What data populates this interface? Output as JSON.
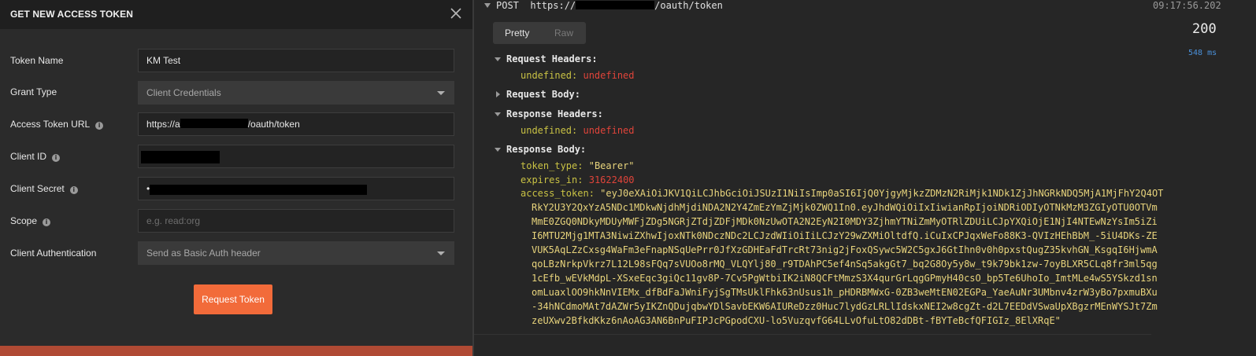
{
  "left": {
    "title": "GET NEW ACCESS TOKEN",
    "fields": {
      "token_name": {
        "label": "Token Name",
        "value": "KM Test"
      },
      "grant_type": {
        "label": "Grant Type",
        "value": "Client Credentials"
      },
      "access_token_url": {
        "label": "Access Token URL",
        "value_prefix": "https://a",
        "value_suffix": "/oauth/token"
      },
      "client_id": {
        "label": "Client ID",
        "value": ""
      },
      "client_secret": {
        "label": "Client Secret",
        "value": "•"
      },
      "scope": {
        "label": "Scope",
        "placeholder": "e.g. read:org"
      },
      "client_auth": {
        "label": "Client Authentication",
        "value": "Send as Basic Auth header"
      }
    },
    "request_button": "Request Token"
  },
  "console": {
    "method": "POST",
    "url_prefix": "https://",
    "url_suffix": "/oauth/token",
    "time": "09:17:56.202",
    "status": "200",
    "duration": "548 ms",
    "tabs": {
      "pretty": "Pretty",
      "raw": "Raw"
    },
    "request_headers": {
      "label": "Request Headers:",
      "key": "undefined:",
      "value": "undefined"
    },
    "request_body": {
      "label": "Request Body:"
    },
    "response_headers": {
      "label": "Response Headers:",
      "key": "undefined:",
      "value": "undefined"
    },
    "response_body": {
      "label": "Response Body:",
      "token_type_key": "token_type:",
      "token_type_value": "\"Bearer\"",
      "expires_in_key": "expires_in:",
      "expires_in_value": "31622400",
      "access_token_key": "access_token:",
      "access_token_lines": [
        "\"eyJ0eXAiOiJKV1QiLCJhbGciOiJSUzI1NiIsImp0aSI6IjQ0YjgyMjkzZDMzN2RiMjk1NDk1ZjJhNGRkNDQ5MjA1MjFhY2Q4OT",
        "RkY2U3Y2QxYzA5NDc1MDkwNjdhMjdiNDA2N2Y4ZmEzYmZjMjk0ZWQ1In0.eyJhdWQiOiIxIiwianRpIjoiNDRiODIyOTNkMzM3ZGIyOTU0OTVm",
        "MmE0ZGQ0NDkyMDUyMWFjZDg5NGRjZTdjZDFjMDk0NzUwOTA2N2EyN2I0MDY3ZjhmYTNiZmMyOTRlZDUiLCJpYXQiOjE1NjI4NTEwNzYsIm5iZi",
        "I6MTU2Mjg1MTA3NiwiZXhwIjoxNTk0NDczNDc2LCJzdWIiOiIiLCJzY29wZXMiOltdfQ.iCuIxCPJqxWeFo88K3-QVIzHEhBbM_-5iU4DKs-ZE",
        "VUK5AqLZzCxsg4WaFm3eFnapNSqUePrr0JfXzGDHEaFdTrcRt73nig2jFoxQSywc5W2C5gxJ6GtIhn0v0h0pxstQugZ35kvhGN_KsgqI6HjwmA",
        "qoLBzNrkpVkrz7L12L98sFQq7sVUOo8rMQ_VLQYlj80_r9TDAhPC5ef4nSq5akgGt7_bq2G8Oy5y8w_t9k79bk1zw-7oyBLXR5CLq8fr3ml5qg",
        "1cEfb_wEVkMdpL-XSxeEqc3giQc11gv8P-7Cv5PgWtbiIK2iN8QCFtMmzS3X4qurGrLqgGPmyH40csO_bp5Te6UhoIo_ImtMLe4wS5YSkzd1sn",
        "omLuaxlOO9hkNnVIEMx_dfBdFaJWniFyjSgTMsUklFhk63nUsus1h_pHDRBMWxG-0ZB3weMtEN02EGPa_YaeAuNr3UMbnv4zrW3yBo7pxmuBXu",
        "-34hNCdmoMAt7dAZWr5yIKZnQDujqbwYDlSavbEKW6AIUReDzz0Huc7lydGzLRLlIdskxNEI2w8cgZt-d2L7EEDdVSwaUpXBgzrMEnWYSJt7Zm",
        "zeUXwv2BfkdKkz6nAoAG3AN6BnPuFIPJcPGpodCXU-lo5VuzqvfG64LLvOfuLtO82dDBt-fBYTeBcfQFIGIz_8ElXRqE\""
      ]
    }
  }
}
